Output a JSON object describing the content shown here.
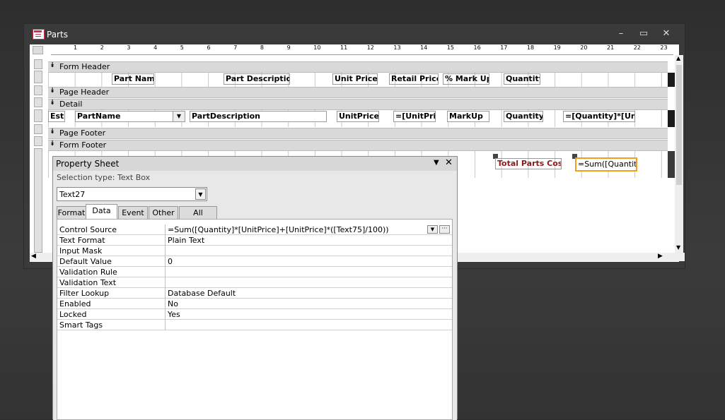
{
  "window": {
    "title": "Parts",
    "minimize": "–",
    "maximize": "▭",
    "close": "✕"
  },
  "ruler": {
    "ticks": [
      "1",
      "2",
      "3",
      "4",
      "5",
      "6",
      "7",
      "8",
      "9",
      "10",
      "11",
      "12",
      "13",
      "14",
      "15",
      "16",
      "17",
      "18",
      "19",
      "20",
      "21",
      "22",
      "23"
    ]
  },
  "sections": {
    "form_header": "Form Header",
    "page_header": "Page Header",
    "detail": "Detail",
    "page_footer": "Page Footer",
    "form_footer": "Form Footer"
  },
  "header_labels": [
    "Part Name",
    "Part Description",
    "Unit Price",
    "Retail Price:",
    "% Mark Up",
    "Quantity"
  ],
  "detail_controls": {
    "est": "Esti",
    "part_name": "PartName",
    "part_description": "PartDescription",
    "unit_price": "UnitPrice",
    "retail_expr": "=[UnitPrice",
    "markup": "MarkUp",
    "quantity": "Quantity",
    "total_expr": "=[Quantity]*[UnitPr"
  },
  "footer_controls": {
    "total_label": "Total Parts Cost",
    "total_expr": "=Sum([Quantity]*"
  },
  "property_sheet": {
    "title": "Property Sheet",
    "selection_type": "Selection type:  Text Box",
    "selected_object": "Text27",
    "tabs": [
      "Format",
      "Data",
      "Event",
      "Other",
      "All"
    ],
    "active_tab": "Data",
    "properties": [
      {
        "name": "Control Source",
        "value": "=Sum([Quantity]*[UnitPrice]+[UnitPrice]*([Text75]/100))"
      },
      {
        "name": "Text Format",
        "value": "Plain Text"
      },
      {
        "name": "Input Mask",
        "value": ""
      },
      {
        "name": "Default Value",
        "value": "0"
      },
      {
        "name": "Validation Rule",
        "value": ""
      },
      {
        "name": "Validation Text",
        "value": ""
      },
      {
        "name": "Filter Lookup",
        "value": "Database Default"
      },
      {
        "name": "Enabled",
        "value": "No"
      },
      {
        "name": "Locked",
        "value": "Yes"
      },
      {
        "name": "Smart Tags",
        "value": ""
      }
    ]
  },
  "colors": {
    "accent_total_label": "#8b1a1a",
    "selection_border": "#f0a020",
    "title_icon": "#c6334b"
  }
}
